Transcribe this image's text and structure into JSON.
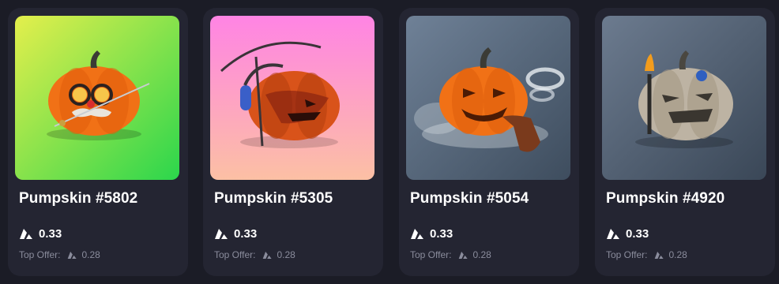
{
  "nfts": [
    {
      "name": "Pumpskin #5802",
      "price": "0.33",
      "offer_label": "Top Offer:",
      "offer_value": "0.28",
      "background": [
        "#e4ef4c",
        "#2bd64c"
      ]
    },
    {
      "name": "Pumpskin #5305",
      "price": "0.33",
      "offer_label": "Top Offer:",
      "offer_value": "0.28",
      "background": [
        "#ff84e4",
        "#fcc0a4"
      ]
    },
    {
      "name": "Pumpskin #5054",
      "price": "0.33",
      "offer_label": "Top Offer:",
      "offer_value": "0.28",
      "background": [
        "#6f8197",
        "#3e4d5e"
      ]
    },
    {
      "name": "Pumpskin #4920",
      "price": "0.33",
      "offer_label": "Top Offer:",
      "offer_value": "0.28",
      "background": [
        "#6c7b8f",
        "#3a4757"
      ]
    }
  ],
  "colors": {
    "page_bg": "#1b1c26",
    "card_bg": "#242532",
    "text": "#ffffff",
    "muted_text": "#8a8c9c"
  },
  "icons": {
    "currency": "avalanche-icon"
  }
}
